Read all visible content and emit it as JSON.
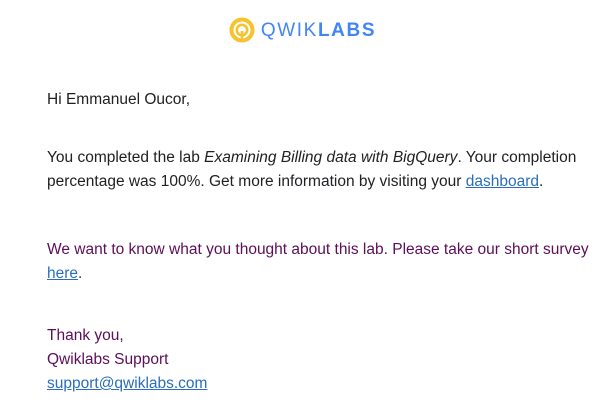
{
  "brand": {
    "logo_icon": "qwiklabs-ring-logo-icon",
    "word_light": "QWIK",
    "word_bold": "LABS",
    "colors": {
      "ring": "#f6c22d",
      "wordmark": "#4285f4"
    }
  },
  "email": {
    "greeting": "Hi Emmanuel Oucor,",
    "completion": {
      "intro": "You completed the lab ",
      "lab_name": "Examining Billing data with BigQuery",
      "middle": ". Your completion percentage was 100%. Get more information by visiting your ",
      "dashboard_link": "dashboard",
      "end": "."
    },
    "survey": {
      "text": "We want to know what you thought about this lab. Please take our short survey ",
      "link": "here",
      "end": "."
    },
    "signoff": {
      "thanks": "Thank you,",
      "team": "Qwiklabs Support",
      "email_link": "support@qwiklabs.com"
    }
  },
  "colors": {
    "body_text": "#202124",
    "purple_text": "#5c0e58",
    "link": "#2a6ebb"
  }
}
